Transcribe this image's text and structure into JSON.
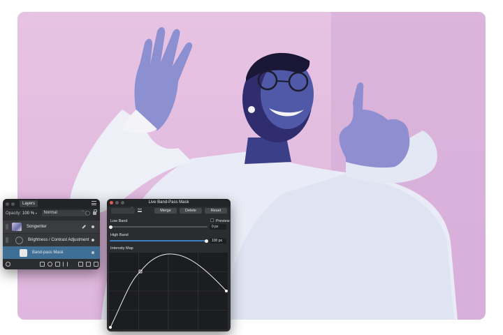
{
  "layers_panel": {
    "tab_label": "Layers",
    "opacity_label": "Opacity:",
    "opacity_value": "100 %",
    "blend_mode": "Normal",
    "layers": [
      {
        "name": "Songwriter",
        "selected": false
      },
      {
        "name": "Brightness / Contrast Adjustment",
        "selected": false
      },
      {
        "name": "Band-pass Mask",
        "selected": true
      }
    ]
  },
  "bandpass_panel": {
    "title": "Live Band-Pass Mask",
    "buttons": {
      "merge": "Merge",
      "delete": "Delete",
      "reset": "Reset"
    },
    "low_band": {
      "label": "Low Band",
      "value": "0 px",
      "level": 0.0
    },
    "high_band": {
      "label": "High Band",
      "value": "100 px",
      "level": 1.0
    },
    "preview_label": "Preview",
    "intensity_map_label": "Intensity Map",
    "accent_color": "#3a82c4"
  }
}
